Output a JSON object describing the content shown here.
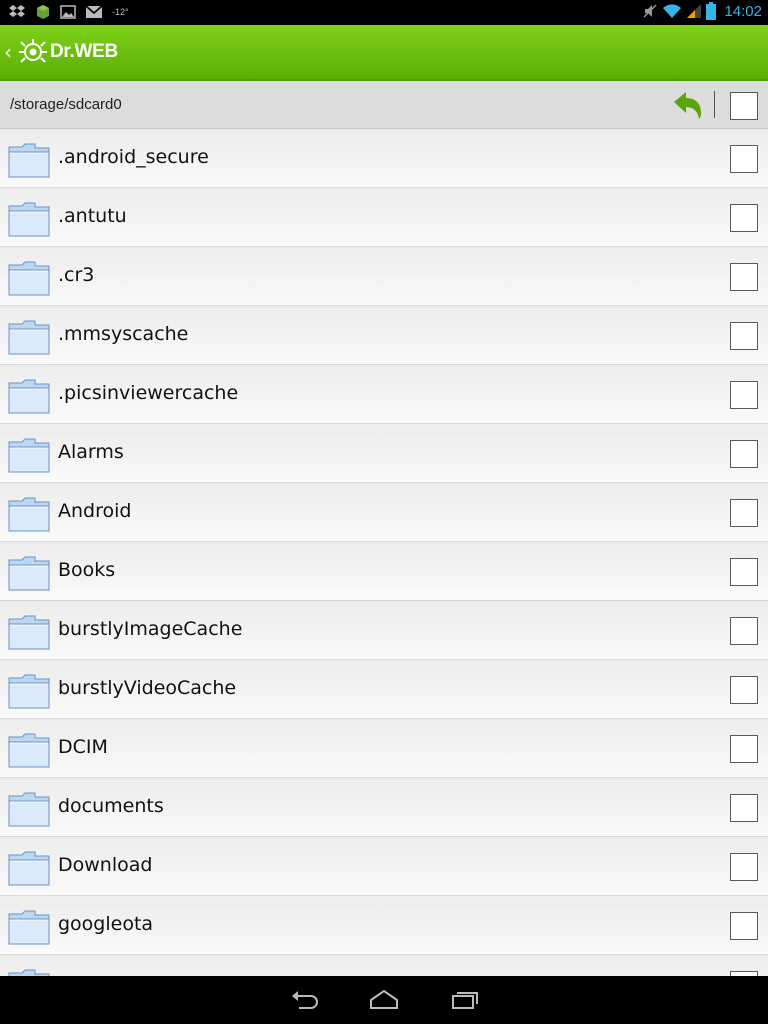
{
  "status_bar": {
    "icons_left": [
      "dropbox-icon",
      "android-icon",
      "image-icon",
      "gmail-icon"
    ],
    "temperature": "-12°",
    "icons_right": [
      "mute-icon",
      "wifi-icon",
      "signal-icon",
      "battery-icon"
    ],
    "time": "14:02"
  },
  "action_bar": {
    "brand": "Dr.WEB",
    "colors": {
      "green": "#6cc10e",
      "clock_blue": "#33b5e5"
    }
  },
  "path_bar": {
    "path": "/storage/sdcard0"
  },
  "files": [
    {
      "name": ".android_secure",
      "type": "folder"
    },
    {
      "name": ".antutu",
      "type": "folder"
    },
    {
      "name": ".cr3",
      "type": "folder"
    },
    {
      "name": ".mmsyscache",
      "type": "folder"
    },
    {
      "name": ".picsinviewercache",
      "type": "folder"
    },
    {
      "name": "Alarms",
      "type": "folder"
    },
    {
      "name": "Android",
      "type": "folder"
    },
    {
      "name": "Books",
      "type": "folder"
    },
    {
      "name": "burstlyImageCache",
      "type": "folder"
    },
    {
      "name": "burstlyVideoCache",
      "type": "folder"
    },
    {
      "name": "DCIM",
      "type": "folder"
    },
    {
      "name": "documents",
      "type": "folder"
    },
    {
      "name": "Download",
      "type": "folder"
    },
    {
      "name": "googleota",
      "type": "folder"
    },
    {
      "name": "",
      "type": "folder"
    }
  ],
  "nav_bar": {
    "buttons": [
      "back-icon",
      "home-icon",
      "recent-apps-icon"
    ]
  }
}
